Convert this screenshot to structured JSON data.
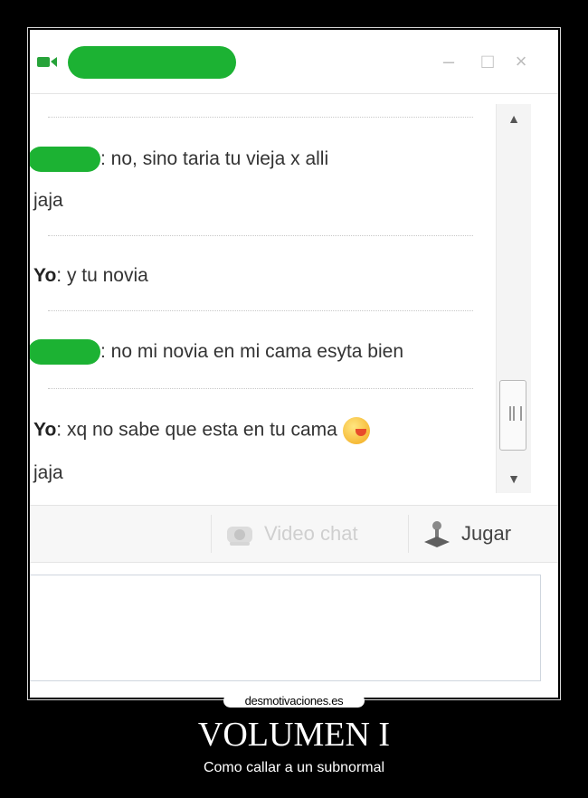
{
  "window": {
    "minimize_glyph": "–",
    "maximize_glyph": "□",
    "close_glyph": "×"
  },
  "messages": [
    {
      "sender": "",
      "text": ": no, sino taria tu vieja x alli",
      "continuation": "jaja"
    },
    {
      "sender": "Yo",
      "text": ": y tu novia"
    },
    {
      "sender": "",
      "text": ": no mi novia en mi cama esyta bien"
    },
    {
      "sender": "Yo",
      "text": ": xq no sabe que esta en tu cama",
      "continuation": "jaja"
    }
  ],
  "scroll": {
    "up_glyph": "▲",
    "down_glyph": "▼"
  },
  "toolbar": {
    "video_chat_label": "Video chat",
    "jugar_label": "Jugar"
  },
  "poster": {
    "brand": "desmotivaciones.es",
    "title": "VOLUMEN I",
    "subtitle": "Como callar a un subnormal"
  },
  "colors": {
    "redaction_green": "#1cb233"
  }
}
